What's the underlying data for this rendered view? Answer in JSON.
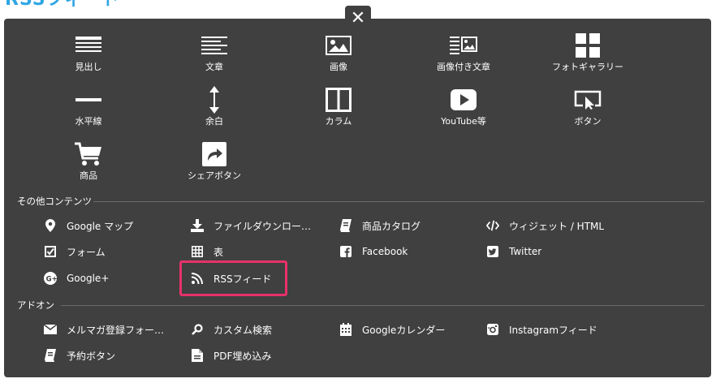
{
  "page_title": "RSSフィード",
  "grid_items": [
    {
      "name": "heading",
      "label": "見出し",
      "icon": "heading-icon"
    },
    {
      "name": "text",
      "label": "文章",
      "icon": "text-icon"
    },
    {
      "name": "image",
      "label": "画像",
      "icon": "image-icon"
    },
    {
      "name": "image-text",
      "label": "画像付き文章",
      "icon": "image-text-icon"
    },
    {
      "name": "photo-gallery",
      "label": "フォトギャラリー",
      "icon": "gallery-icon"
    },
    {
      "name": "horizontal-line",
      "label": "水平線",
      "icon": "horizontal-line-icon"
    },
    {
      "name": "spacer",
      "label": "余白",
      "icon": "vertical-arrows-icon"
    },
    {
      "name": "column",
      "label": "カラム",
      "icon": "column-icon"
    },
    {
      "name": "youtube",
      "label": "YouTube等",
      "icon": "play-icon"
    },
    {
      "name": "button",
      "label": "ボタン",
      "icon": "cursor-button-icon"
    },
    {
      "name": "product",
      "label": "商品",
      "icon": "cart-icon"
    },
    {
      "name": "share-button",
      "label": "シェアボタン",
      "icon": "share-icon"
    }
  ],
  "other_section": {
    "title": "その他コンテンツ",
    "items": [
      {
        "name": "google-map",
        "label": "Google マップ",
        "icon": "map-pin-icon"
      },
      {
        "name": "file-download",
        "label": "ファイルダウンロー…",
        "icon": "download-icon"
      },
      {
        "name": "product-catalog",
        "label": "商品カタログ",
        "icon": "catalog-icon"
      },
      {
        "name": "widget-html",
        "label": "ウィジェット / HTML",
        "icon": "code-icon"
      },
      {
        "name": "form",
        "label": "フォーム",
        "icon": "checkbox-icon"
      },
      {
        "name": "table",
        "label": "表",
        "icon": "table-icon"
      },
      {
        "name": "facebook",
        "label": "Facebook",
        "icon": "facebook-icon"
      },
      {
        "name": "twitter",
        "label": "Twitter",
        "icon": "twitter-icon"
      },
      {
        "name": "google-plus",
        "label": "Google+",
        "icon": "google-plus-icon"
      },
      {
        "name": "rss-feed",
        "label": "RSSフィード",
        "icon": "rss-icon"
      }
    ]
  },
  "addon_section": {
    "title": "アドオン",
    "items": [
      {
        "name": "newsletter-form",
        "label": "メルマガ登録フォー…",
        "icon": "mail-icon"
      },
      {
        "name": "custom-search",
        "label": "カスタム検索",
        "icon": "search-icon"
      },
      {
        "name": "google-calendar",
        "label": "Googleカレンダー",
        "icon": "calendar-icon"
      },
      {
        "name": "instagram-feed",
        "label": "Instagramフィード",
        "icon": "instagram-icon"
      },
      {
        "name": "reservation-button",
        "label": "予約ボタン",
        "icon": "book-icon"
      },
      {
        "name": "pdf-embed",
        "label": "PDF埋め込み",
        "icon": "pdf-icon"
      }
    ]
  },
  "colors": {
    "panel": "#404040",
    "highlight": "#e8316b",
    "title": "#2fa6e4"
  },
  "close_symbol": "✕"
}
